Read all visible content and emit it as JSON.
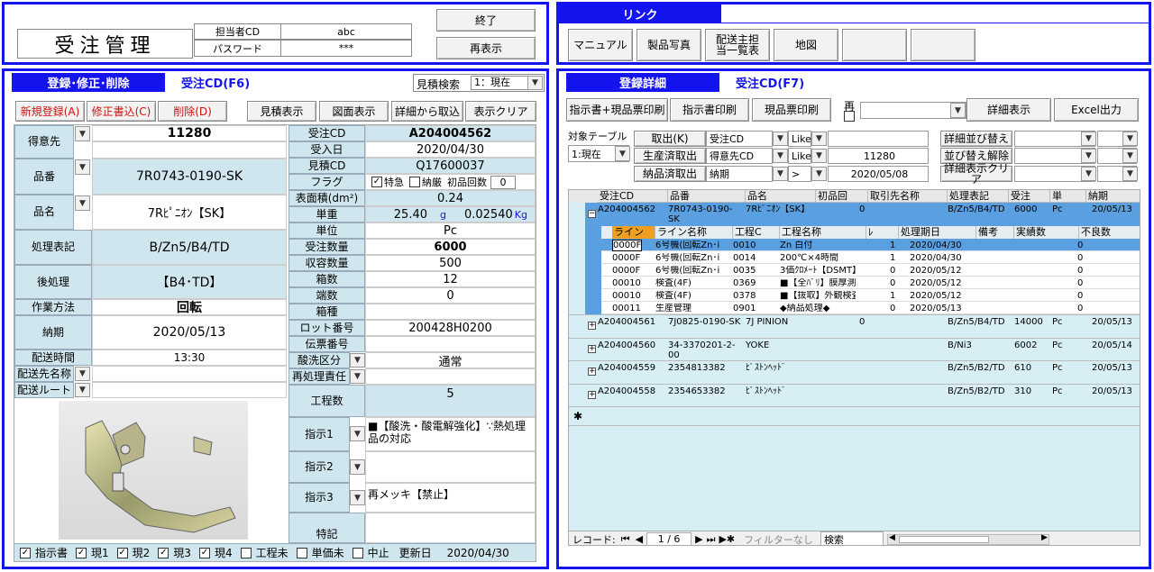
{
  "app": {
    "title": "受注管理"
  },
  "login": {
    "user_cd_label": "担当者CD",
    "user_cd": "abc",
    "password_label": "パスワード",
    "password": "***"
  },
  "top_buttons": {
    "exit": "終了",
    "refresh": "再表示"
  },
  "links": {
    "title": "リンク",
    "items": [
      "マニュアル",
      "製品写真",
      "配送主担当一覧表",
      "地図",
      "",
      ""
    ]
  },
  "left": {
    "header": "登録･修正･削除",
    "order_label": "受注CD(F6)",
    "estimate_search_label": "見積検索",
    "estimate_search_value": "1：現在",
    "buttons": {
      "new": "新規登録(A)",
      "edit": "修正書込(C)",
      "delete": "削除(D)",
      "estimate": "見積表示",
      "drawing": "図面表示",
      "import": "詳細から取込",
      "clear": "表示クリア"
    },
    "fields": {
      "customer_label": "得意先",
      "customer_cd": "11280",
      "part_no_label": "品番",
      "part_no": "7R0743-0190-SK",
      "part_name_label": "品名",
      "part_name": "7Rﾋﾟﾆｵﾝ【SK】",
      "process_label": "処理表記",
      "process": "B/Zn5/B4/TD",
      "post_label": "後処理",
      "post": "【B4･TD】",
      "method_label": "作業方法",
      "method": "回転",
      "due_label": "納期",
      "due": "2020/05/13",
      "delivery_time_label": "配送時間",
      "delivery_time": "13:30",
      "delivery_name_label": "配送先名称",
      "delivery_route_label": "配送ルート",
      "order_cd_label": "受注CD",
      "order_cd": "A204004562",
      "order_date_label": "受入日",
      "order_date": "2020/04/30",
      "estimate_cd_label": "見積CD",
      "estimate_cd": "Q17600037",
      "flag_label": "フラグ",
      "flag_special": "特急",
      "flag_strict": "納厳",
      "flag_first": "初品回数",
      "flag_first_value": "0",
      "surface_label": "表面積(dm²)",
      "surface": "0.24",
      "unit_weight_label": "単重",
      "unit_weight_g": "25.40",
      "unit_g": "g",
      "unit_weight_kg": "0.02540",
      "unit_kg": "Kg",
      "unit_label": "単位",
      "unit": "Pc",
      "qty_label": "受注数量",
      "qty": "6000",
      "box_qty_label": "収容数量",
      "box_qty": "500",
      "boxes_label": "箱数",
      "boxes": "12",
      "remainder_label": "端数",
      "remainder": "0",
      "box_type_label": "箱種",
      "box_type": "",
      "lot_label": "ロット番号",
      "lot": "200428H0200",
      "slip_label": "伝票番号",
      "slip": "",
      "pickling_label": "酸洗区分",
      "pickling": "通常",
      "reprocess_label": "再処理責任",
      "reprocess": "",
      "steps_label": "工程数",
      "steps": "5",
      "instr1_label": "指示1",
      "instr1": "■【酸洗・酸電解強化】∵熱処理品の対応",
      "instr2_label": "指示2",
      "instr2": "",
      "instr3_label": "指示3",
      "instr3": "再メッキ【禁止】",
      "special_label": "特記",
      "special": ""
    },
    "footer": {
      "c1": "指示書",
      "c2": "現1",
      "c3": "現2",
      "c4": "現3",
      "c5": "現4",
      "c6": "工程未",
      "c7": "単価未",
      "c8": "中止",
      "updated_label": "更新日",
      "updated": "2020/04/30"
    }
  },
  "right": {
    "header": "登録詳細",
    "order_label": "受注CD(F7)",
    "buttons": {
      "print_all": "指示書+現品票印刷",
      "print_instr": "指示書印刷",
      "print_tag": "現品票印刷",
      "re": "再",
      "detail": "詳細表示",
      "excel": "Excel出力"
    },
    "filter": {
      "table_label": "対象テーブル",
      "table_value": "1:現在",
      "fetch": "取出(K)",
      "production": "生産済取出",
      "delivered": "納品済取出",
      "row1_field": "受注CD",
      "row1_op": "Like",
      "row1_val": "",
      "row2_field": "得意先CD",
      "row2_op": "Like",
      "row2_val": "11280",
      "row3_field": "納期",
      "row3_op": ">",
      "row3_val": "2020/05/08",
      "sort": "詳細並び替え",
      "unsort": "並び替え解除",
      "sort_clear": "詳細表示クリア"
    },
    "grid": {
      "columns": [
        "受注CD",
        "品番",
        "品名",
        "初品回",
        "取引先名称",
        "処理表記",
        "受注",
        "単",
        "納期"
      ],
      "rows": [
        {
          "cd": "A204004562",
          "part": "7R0743-0190-SK",
          "name": "7Rﾋﾟﾆｵﾝ【SK】",
          "first": "0",
          "proc": "B/Zn5/B4/TD",
          "qty": "6000",
          "unit": "Pc",
          "due": "20/05/13"
        },
        {
          "cd": "A204004561",
          "part": "7J0825-0190-SK",
          "name": "7J PINION",
          "first": "0",
          "proc": "B/Zn5/B4/TD",
          "qty": "14000",
          "unit": "Pc",
          "due": "20/05/13"
        },
        {
          "cd": "A204004560",
          "part": "34-3370201-2-00",
          "name": "YOKE",
          "first": "",
          "proc": "B/Ni3",
          "qty": "6002",
          "unit": "Pc",
          "due": "20/05/14"
        },
        {
          "cd": "A204004559",
          "part": "2354813382",
          "name": "ﾋﾟｽﾄﾝﾍｯﾄﾞ",
          "first": "",
          "proc": "B/Zn5/B2/TD",
          "qty": "610",
          "unit": "Pc",
          "due": "20/05/13"
        },
        {
          "cd": "A204004558",
          "part": "2354653382",
          "name": "ﾋﾟｽﾄﾝﾍｯﾄﾞ",
          "first": "",
          "proc": "B/Zn5/B2/TD",
          "qty": "310",
          "unit": "Pc",
          "due": "20/05/13"
        }
      ],
      "sub_columns": [
        "ライン",
        "ライン名称",
        "工程C",
        "工程名称",
        "ﾚ",
        "処理期日",
        "備考",
        "実績数",
        "不良数"
      ],
      "sub_rows": [
        {
          "line": "0000F",
          "line_name": "6号機(回転Zn･i",
          "step": "0010",
          "step_name": "Zn 白付",
          "r": "1",
          "date": "2020/04/30",
          "done": "0"
        },
        {
          "line": "0000F",
          "line_name": "6号機(回転Zn･i",
          "step": "0014",
          "step_name": "200℃×4時間",
          "r": "1",
          "date": "2020/04/30",
          "done": "0"
        },
        {
          "line": "0000F",
          "line_name": "6号機(回転Zn･i",
          "step": "0035",
          "step_name": "3価ｸﾛﾒｰﾄ【DSMT】",
          "r": "0",
          "date": "2020/05/12",
          "done": "0"
        },
        {
          "line": "00010",
          "line_name": "検査(4F)",
          "step": "0369",
          "step_name": "■【全ﾊﾞﾘ】膜厚測定",
          "r": "0",
          "date": "2020/05/12",
          "done": "0"
        },
        {
          "line": "00010",
          "line_name": "検査(4F)",
          "step": "0378",
          "step_name": "■【抜取】外観検査",
          "r": "1",
          "date": "2020/05/12",
          "done": "0"
        },
        {
          "line": "00011",
          "line_name": "生産管理",
          "step": "0901",
          "step_name": "◆納品処理◆",
          "r": "0",
          "date": "2020/05/13",
          "done": "0"
        }
      ]
    },
    "nav": {
      "record_label": "レコード:",
      "position": "1 / 6",
      "filter": "フィルターなし",
      "search": "検索"
    }
  },
  "colors": {
    "accent": "#1414ee",
    "label_bg": "#cfe6ee",
    "grid_bg": "#d6eef4"
  }
}
